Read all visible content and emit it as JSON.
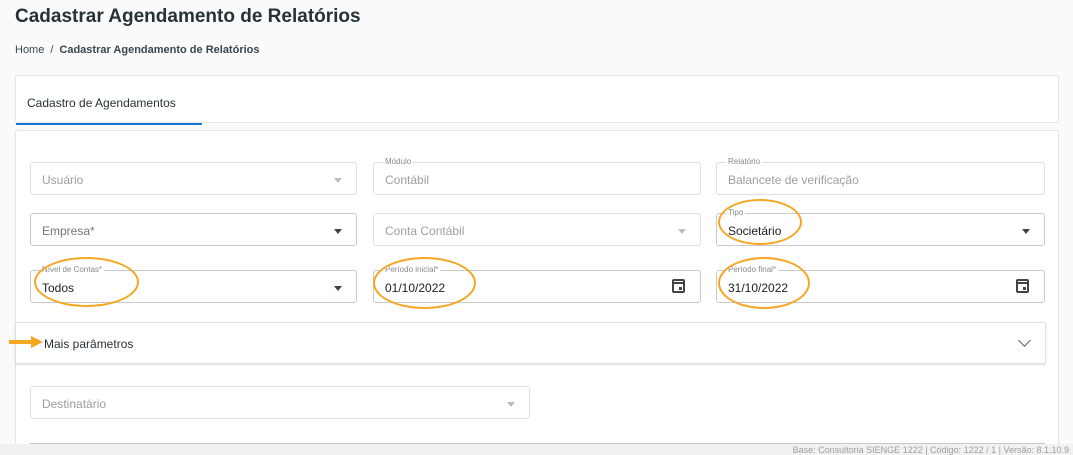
{
  "page": {
    "title": "Cadastrar Agendamento de Relatórios"
  },
  "breadcrumb": {
    "home": "Home",
    "separator": "/",
    "current": "Cadastrar Agendamento de Relatórios"
  },
  "tabs": [
    {
      "label": "Cadastro de Agendamentos",
      "active": true
    }
  ],
  "form": {
    "usuario": {
      "placeholder": "Usuário"
    },
    "modulo": {
      "label": "Módulo",
      "value": "Contábil"
    },
    "relatorio": {
      "label": "Relatório",
      "value": "Balancete de verificação"
    },
    "empresa": {
      "placeholder": "Empresa*"
    },
    "conta_contabil": {
      "placeholder": "Conta Contábil"
    },
    "tipo": {
      "label": "Tipo",
      "value": "Societário"
    },
    "nivel_contas": {
      "label": "Nível de Contas*",
      "value": "Todos"
    },
    "periodo_inicial": {
      "label": "Período inicial*",
      "value": "01/10/2022"
    },
    "periodo_final": {
      "label": "Período final*",
      "value": "31/10/2022"
    },
    "mais_parametros": {
      "label": "Mais parâmetros"
    },
    "destinatario": {
      "placeholder": "Destinatário"
    }
  },
  "footer": {
    "text": "Base: Consultoria SIENGE 1222 | Código: 1222 / 1 | Versão: 8.1.10.9"
  },
  "colors": {
    "accent": "#1976d2",
    "highlight": "#f5a623"
  },
  "icons": [
    "chevron-down-icon",
    "calendar-icon",
    "expand-chevron-icon",
    "arrow-annotation-icon"
  ]
}
